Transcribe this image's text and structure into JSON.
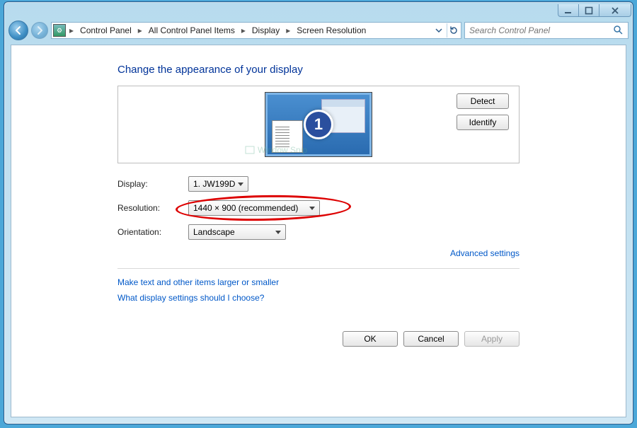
{
  "titlebar": {},
  "nav": {
    "breadcrumbs": [
      "Control Panel",
      "All Control Panel Items",
      "Display",
      "Screen Resolution"
    ]
  },
  "search": {
    "placeholder": "Search Control Panel"
  },
  "page": {
    "title": "Change the appearance of your display",
    "monitor_number": "1",
    "detect_label": "Detect",
    "identify_label": "Identify",
    "display_label": "Display:",
    "display_value": "1. JW199D",
    "resolution_label": "Resolution:",
    "resolution_value": "1440 × 900 (recommended)",
    "orientation_label": "Orientation:",
    "orientation_value": "Landscape",
    "advanced_link": "Advanced settings",
    "help1": "Make text and other items larger or smaller",
    "help2": "What display settings should I choose?",
    "ok": "OK",
    "cancel": "Cancel",
    "apply": "Apply",
    "snip_watermark": "Window Snip"
  }
}
